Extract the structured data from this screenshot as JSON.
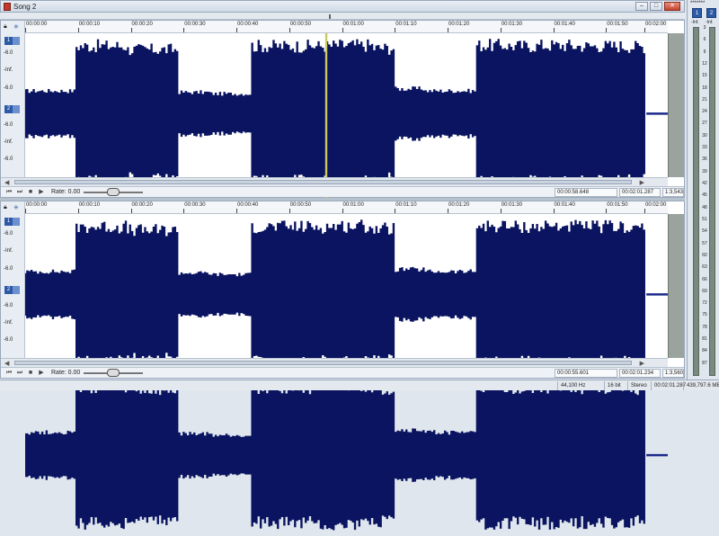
{
  "window": {
    "title": "Song 2"
  },
  "ruler_ticks": [
    "00:00:00",
    "00:00:10",
    "00:00:20",
    "00:00:30",
    "00:00:40",
    "00:00:50",
    "00:01:00",
    "00:01:10",
    "00:01:20",
    "00:01:30",
    "00:01:40",
    "00:01:50",
    "00:02:00"
  ],
  "channel_labels": {
    "ch1": "1",
    "ch2": "2"
  },
  "db_labels": {
    "minus6": "-6.0",
    "neg_inf": "-Inf."
  },
  "pane1": {
    "rate_label": "Rate: 0.00",
    "position": "00:00:58.648",
    "length": "00:02:01.287",
    "zoom": "1:3,543"
  },
  "pane2": {
    "rate_label": "Rate: 0.00",
    "position": "00:00:55.601",
    "length": "00:02:01.234",
    "zoom": "1:3,560"
  },
  "meter": {
    "dots": "*******",
    "ch1": "1",
    "ch2": "2",
    "neg_inf": "-Inf.",
    "scale": [
      "3",
      "6",
      "9",
      "12",
      "15",
      "18",
      "21",
      "24",
      "27",
      "30",
      "33",
      "36",
      "39",
      "42",
      "45",
      "48",
      "51",
      "54",
      "57",
      "60",
      "63",
      "66",
      "69",
      "72",
      "75",
      "78",
      "81",
      "84",
      "87"
    ]
  },
  "status": {
    "sample_rate": "44,100 Hz",
    "bit_depth": "16 bit",
    "channels": "Stereo",
    "duration": "00:02:01.287",
    "disk": "439,797.6 MB"
  },
  "colors": {
    "waveform": "#0a1460",
    "cursor": "#c9c960",
    "meter_bg": "#7a8a80"
  },
  "waveform_envelope": [
    0.32,
    0.95,
    0.9,
    0.3,
    0.28,
    0.95,
    0.95,
    0.96,
    0.92,
    0.35,
    0.32,
    0.96,
    0.95,
    0.96,
    0.95,
    0.95,
    0.94,
    0.35
  ],
  "waveform_segments_sec": [
    0,
    10,
    20,
    30,
    36,
    44,
    52,
    60,
    68,
    72,
    78,
    88,
    94,
    100,
    106,
    112,
    118,
    121
  ]
}
